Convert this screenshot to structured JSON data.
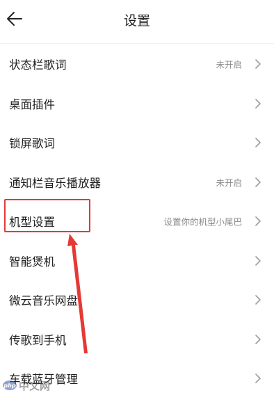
{
  "header": {
    "title": "设置",
    "back_icon": "back-arrow-icon"
  },
  "settings": {
    "items": [
      {
        "label": "状态栏歌词",
        "value": "未开启"
      },
      {
        "label": "桌面插件",
        "value": ""
      },
      {
        "label": "锁屏歌词",
        "value": ""
      },
      {
        "label": "通知栏音乐播放器",
        "value": "未开启"
      },
      {
        "label": "机型设置",
        "value": "设置你的机型小尾巴"
      },
      {
        "label": "智能煲机",
        "value": ""
      },
      {
        "label": "微云音乐网盘",
        "value": ""
      },
      {
        "label": "传歌到手机",
        "value": ""
      },
      {
        "label": "车载蓝牙管理",
        "value": ""
      }
    ],
    "chevron_icon": "chevron-right-icon"
  },
  "annotation": {
    "highlight_color": "#e53935",
    "highlighted_item": "机型设置"
  },
  "watermark": {
    "logo_text": "php",
    "text": "中文网"
  },
  "colors": {
    "label": "#1e1e1e",
    "value": "#8a8a8a",
    "chevron": "#9e9e9e",
    "annotation": "#e53935"
  }
}
